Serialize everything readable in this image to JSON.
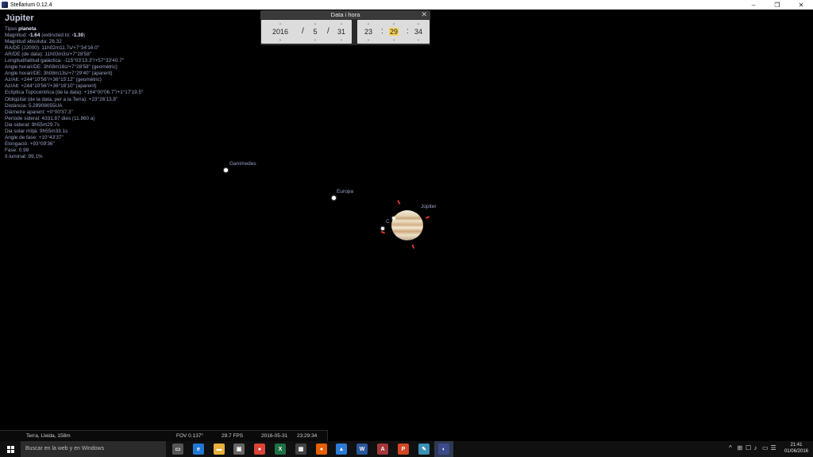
{
  "window": {
    "title": "Stellarium 0.12.4",
    "controls": [
      "–",
      "❐",
      "✕"
    ]
  },
  "info": {
    "title": "Júpiter",
    "lines": [
      {
        "pre": "Tipus ",
        "bold": "planeta",
        "post": ""
      },
      {
        "pre": "Magnitud: ",
        "bold": "-1.64",
        "post": " (extincted to: ",
        "bold2": "-1.30",
        "post2": ")"
      },
      {
        "pre": "Magnitud absoluta: 26.32"
      },
      {
        "pre": "RA/DE (J2000): 11h02m11.7s/+7°34'16.0\""
      },
      {
        "pre": "AR/DE (de data): 11h03m3s/+7°28'58\""
      },
      {
        "pre": "Longitud/latitud galàctica: -115°03'13.3\"/+57°33'40.7\""
      },
      {
        "pre": "Angle horari/DE: 3h08m16s/+7°28'58\" (geomètric)"
      },
      {
        "pre": "Angle horari/DE: 3h08m13s/+7°29'40\" (aparent)"
      },
      {
        "pre": "Az/Alt: +244°10'56\"/+36°15'12\" (geomètric)"
      },
      {
        "pre": "Az/Alt: +244°10'56\"/+36°16'10\" (aparent)"
      },
      {
        "pre": "Eclíptica Topocèntrica (de la data): +164°00'06.7\"/+1°17'19.5\""
      },
      {
        "pre": "Obliqüitat (de la data, per a la Terra): +23°26'13.8\""
      },
      {
        "pre": "Distància: 5.28908055UA"
      },
      {
        "pre": "Diàmetre aparent: +0°00'37.3\""
      },
      {
        "pre": "Període sideral: 4331.87 dies (11.860 a)"
      },
      {
        "pre": "Dia sideral: 9h55m29.7s"
      },
      {
        "pre": "Dia solar mitjà: 9h55m33.1s"
      },
      {
        "pre": "Angle de fase: +10°43'37\""
      },
      {
        "pre": "Elongació: +93°09'36\""
      },
      {
        "pre": "Fase: 0.99"
      },
      {
        "pre": "Il·luminat: 99.1%"
      }
    ]
  },
  "datetime_dialog": {
    "title": "Data i hora",
    "close": "✕",
    "year": "2016",
    "month": "5",
    "day": "31",
    "hour": "23",
    "minute": "29",
    "second": "34",
    "sep_date": "/",
    "sep_time": ":"
  },
  "sky_labels": {
    "ganymede": "Ganímedes",
    "europa": "Europa",
    "jupiter": "Júpiter",
    "callisto_partial": "C"
  },
  "status_bar": {
    "location": "Terra, Lleida, 158m",
    "fov": "FOV 0.137°",
    "fps": "29.7 FPS",
    "date": "2016-05-31",
    "time": "23:29:34"
  },
  "taskbar": {
    "search_placeholder": "Buscar en la web y en Windows",
    "apps": [
      {
        "name": "task-view-icon",
        "glyph": "▭",
        "color": "#555"
      },
      {
        "name": "edge-icon",
        "glyph": "e",
        "color": "#1e78d4"
      },
      {
        "name": "file-explorer-icon",
        "glyph": "▬",
        "color": "#e8b23a"
      },
      {
        "name": "store-icon",
        "glyph": "▣",
        "color": "#666"
      },
      {
        "name": "chrome-icon",
        "glyph": "●",
        "color": "#db4437"
      },
      {
        "name": "excel-icon",
        "glyph": "X",
        "color": "#1e7145"
      },
      {
        "name": "calculator-icon",
        "glyph": "▦",
        "color": "#444"
      },
      {
        "name": "firefox-icon",
        "glyph": "●",
        "color": "#e66000"
      },
      {
        "name": "photos-icon",
        "glyph": "▲",
        "color": "#2d7bd6"
      },
      {
        "name": "word-icon",
        "glyph": "W",
        "color": "#2b579a"
      },
      {
        "name": "access-icon",
        "glyph": "A",
        "color": "#a4373a"
      },
      {
        "name": "powerpoint-icon",
        "glyph": "P",
        "color": "#d24726"
      },
      {
        "name": "notepad-icon",
        "glyph": "✎",
        "color": "#3c8fb5"
      },
      {
        "name": "stellarium-icon",
        "glyph": "◐",
        "color": "#3a4a8a"
      }
    ],
    "tray": [
      "^",
      "⊞",
      "☐",
      "♪",
      "▭",
      "☰"
    ],
    "clock_time": "21:41",
    "clock_date": "01/06/2016"
  }
}
